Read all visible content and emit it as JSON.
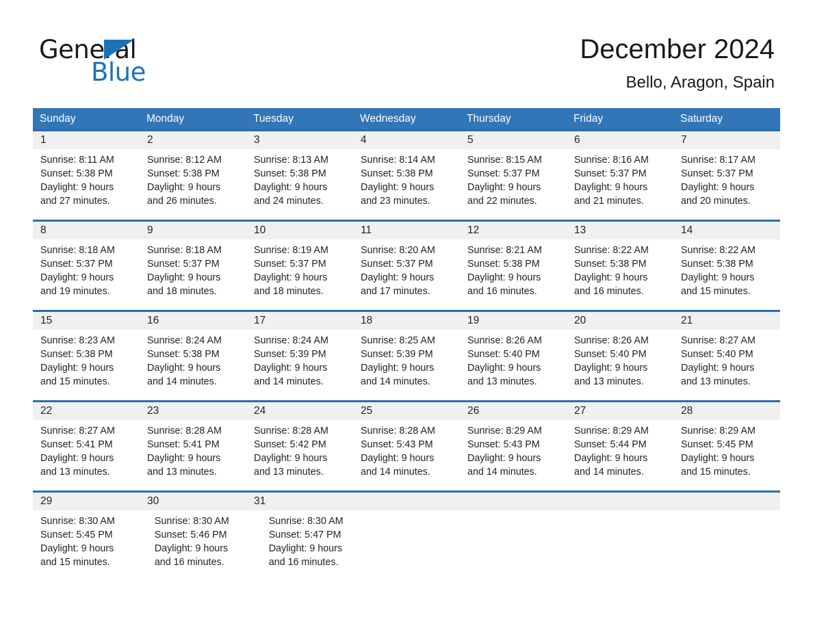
{
  "brand": {
    "word_one": "General",
    "word_two": "Blue",
    "triangle_color": "#1c72b8"
  },
  "header": {
    "title": "December 2024",
    "location": "Bello, Aragon, Spain"
  },
  "theme": {
    "header_blue": "#3276b8",
    "row_divider_blue": "#2a6db0",
    "daynum_band": "#f0f0f0",
    "text": "#231f20"
  },
  "weekdays": [
    "Sunday",
    "Monday",
    "Tuesday",
    "Wednesday",
    "Thursday",
    "Friday",
    "Saturday"
  ],
  "weeks": [
    [
      {
        "day": "1",
        "sunrise": "Sunrise: 8:11 AM",
        "sunset": "Sunset: 5:38 PM",
        "daylight_line1": "Daylight: 9 hours",
        "daylight_line2": "and 27 minutes."
      },
      {
        "day": "2",
        "sunrise": "Sunrise: 8:12 AM",
        "sunset": "Sunset: 5:38 PM",
        "daylight_line1": "Daylight: 9 hours",
        "daylight_line2": "and 26 minutes."
      },
      {
        "day": "3",
        "sunrise": "Sunrise: 8:13 AM",
        "sunset": "Sunset: 5:38 PM",
        "daylight_line1": "Daylight: 9 hours",
        "daylight_line2": "and 24 minutes."
      },
      {
        "day": "4",
        "sunrise": "Sunrise: 8:14 AM",
        "sunset": "Sunset: 5:38 PM",
        "daylight_line1": "Daylight: 9 hours",
        "daylight_line2": "and 23 minutes."
      },
      {
        "day": "5",
        "sunrise": "Sunrise: 8:15 AM",
        "sunset": "Sunset: 5:37 PM",
        "daylight_line1": "Daylight: 9 hours",
        "daylight_line2": "and 22 minutes."
      },
      {
        "day": "6",
        "sunrise": "Sunrise: 8:16 AM",
        "sunset": "Sunset: 5:37 PM",
        "daylight_line1": "Daylight: 9 hours",
        "daylight_line2": "and 21 minutes."
      },
      {
        "day": "7",
        "sunrise": "Sunrise: 8:17 AM",
        "sunset": "Sunset: 5:37 PM",
        "daylight_line1": "Daylight: 9 hours",
        "daylight_line2": "and 20 minutes."
      }
    ],
    [
      {
        "day": "8",
        "sunrise": "Sunrise: 8:18 AM",
        "sunset": "Sunset: 5:37 PM",
        "daylight_line1": "Daylight: 9 hours",
        "daylight_line2": "and 19 minutes."
      },
      {
        "day": "9",
        "sunrise": "Sunrise: 8:18 AM",
        "sunset": "Sunset: 5:37 PM",
        "daylight_line1": "Daylight: 9 hours",
        "daylight_line2": "and 18 minutes."
      },
      {
        "day": "10",
        "sunrise": "Sunrise: 8:19 AM",
        "sunset": "Sunset: 5:37 PM",
        "daylight_line1": "Daylight: 9 hours",
        "daylight_line2": "and 18 minutes."
      },
      {
        "day": "11",
        "sunrise": "Sunrise: 8:20 AM",
        "sunset": "Sunset: 5:37 PM",
        "daylight_line1": "Daylight: 9 hours",
        "daylight_line2": "and 17 minutes."
      },
      {
        "day": "12",
        "sunrise": "Sunrise: 8:21 AM",
        "sunset": "Sunset: 5:38 PM",
        "daylight_line1": "Daylight: 9 hours",
        "daylight_line2": "and 16 minutes."
      },
      {
        "day": "13",
        "sunrise": "Sunrise: 8:22 AM",
        "sunset": "Sunset: 5:38 PM",
        "daylight_line1": "Daylight: 9 hours",
        "daylight_line2": "and 16 minutes."
      },
      {
        "day": "14",
        "sunrise": "Sunrise: 8:22 AM",
        "sunset": "Sunset: 5:38 PM",
        "daylight_line1": "Daylight: 9 hours",
        "daylight_line2": "and 15 minutes."
      }
    ],
    [
      {
        "day": "15",
        "sunrise": "Sunrise: 8:23 AM",
        "sunset": "Sunset: 5:38 PM",
        "daylight_line1": "Daylight: 9 hours",
        "daylight_line2": "and 15 minutes."
      },
      {
        "day": "16",
        "sunrise": "Sunrise: 8:24 AM",
        "sunset": "Sunset: 5:38 PM",
        "daylight_line1": "Daylight: 9 hours",
        "daylight_line2": "and 14 minutes."
      },
      {
        "day": "17",
        "sunrise": "Sunrise: 8:24 AM",
        "sunset": "Sunset: 5:39 PM",
        "daylight_line1": "Daylight: 9 hours",
        "daylight_line2": "and 14 minutes."
      },
      {
        "day": "18",
        "sunrise": "Sunrise: 8:25 AM",
        "sunset": "Sunset: 5:39 PM",
        "daylight_line1": "Daylight: 9 hours",
        "daylight_line2": "and 14 minutes."
      },
      {
        "day": "19",
        "sunrise": "Sunrise: 8:26 AM",
        "sunset": "Sunset: 5:40 PM",
        "daylight_line1": "Daylight: 9 hours",
        "daylight_line2": "and 13 minutes."
      },
      {
        "day": "20",
        "sunrise": "Sunrise: 8:26 AM",
        "sunset": "Sunset: 5:40 PM",
        "daylight_line1": "Daylight: 9 hours",
        "daylight_line2": "and 13 minutes."
      },
      {
        "day": "21",
        "sunrise": "Sunrise: 8:27 AM",
        "sunset": "Sunset: 5:40 PM",
        "daylight_line1": "Daylight: 9 hours",
        "daylight_line2": "and 13 minutes."
      }
    ],
    [
      {
        "day": "22",
        "sunrise": "Sunrise: 8:27 AM",
        "sunset": "Sunset: 5:41 PM",
        "daylight_line1": "Daylight: 9 hours",
        "daylight_line2": "and 13 minutes."
      },
      {
        "day": "23",
        "sunrise": "Sunrise: 8:28 AM",
        "sunset": "Sunset: 5:41 PM",
        "daylight_line1": "Daylight: 9 hours",
        "daylight_line2": "and 13 minutes."
      },
      {
        "day": "24",
        "sunrise": "Sunrise: 8:28 AM",
        "sunset": "Sunset: 5:42 PM",
        "daylight_line1": "Daylight: 9 hours",
        "daylight_line2": "and 13 minutes."
      },
      {
        "day": "25",
        "sunrise": "Sunrise: 8:28 AM",
        "sunset": "Sunset: 5:43 PM",
        "daylight_line1": "Daylight: 9 hours",
        "daylight_line2": "and 14 minutes."
      },
      {
        "day": "26",
        "sunrise": "Sunrise: 8:29 AM",
        "sunset": "Sunset: 5:43 PM",
        "daylight_line1": "Daylight: 9 hours",
        "daylight_line2": "and 14 minutes."
      },
      {
        "day": "27",
        "sunrise": "Sunrise: 8:29 AM",
        "sunset": "Sunset: 5:44 PM",
        "daylight_line1": "Daylight: 9 hours",
        "daylight_line2": "and 14 minutes."
      },
      {
        "day": "28",
        "sunrise": "Sunrise: 8:29 AM",
        "sunset": "Sunset: 5:45 PM",
        "daylight_line1": "Daylight: 9 hours",
        "daylight_line2": "and 15 minutes."
      }
    ],
    [
      {
        "day": "29",
        "sunrise": "Sunrise: 8:30 AM",
        "sunset": "Sunset: 5:45 PM",
        "daylight_line1": "Daylight: 9 hours",
        "daylight_line2": "and 15 minutes."
      },
      {
        "day": "30",
        "sunrise": "Sunrise: 8:30 AM",
        "sunset": "Sunset: 5:46 PM",
        "daylight_line1": "Daylight: 9 hours",
        "daylight_line2": "and 16 minutes."
      },
      {
        "day": "31",
        "sunrise": "Sunrise: 8:30 AM",
        "sunset": "Sunset: 5:47 PM",
        "daylight_line1": "Daylight: 9 hours",
        "daylight_line2": "and 16 minutes."
      },
      {
        "day": "",
        "sunrise": "",
        "sunset": "",
        "daylight_line1": "",
        "daylight_line2": ""
      },
      {
        "day": "",
        "sunrise": "",
        "sunset": "",
        "daylight_line1": "",
        "daylight_line2": ""
      },
      {
        "day": "",
        "sunrise": "",
        "sunset": "",
        "daylight_line1": "",
        "daylight_line2": ""
      },
      {
        "day": "",
        "sunrise": "",
        "sunset": "",
        "daylight_line1": "",
        "daylight_line2": ""
      }
    ]
  ]
}
